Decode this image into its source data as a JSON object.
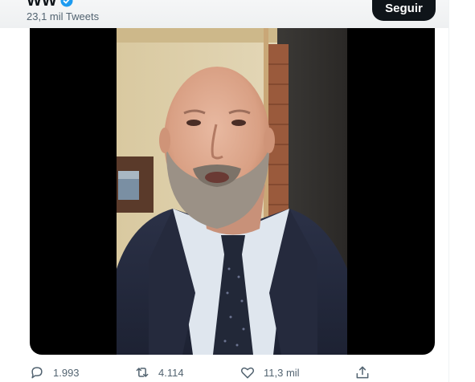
{
  "header": {
    "account_name": "WW",
    "tweet_count": "23,1 mil Tweets",
    "follow_label": "Seguir"
  },
  "media": {
    "type": "video"
  },
  "actions": {
    "reply_count": "1.993",
    "retweet_count": "4.114",
    "like_count": "11,3 mil"
  },
  "colors": {
    "text_primary": "#0f1419",
    "text_secondary": "#536471",
    "verified_blue": "#1d9bf0",
    "follow_button_bg": "#0f1419",
    "media_bg": "#000000"
  },
  "icons": [
    "verified-icon",
    "reply-icon",
    "retweet-icon",
    "like-icon",
    "share-icon"
  ]
}
